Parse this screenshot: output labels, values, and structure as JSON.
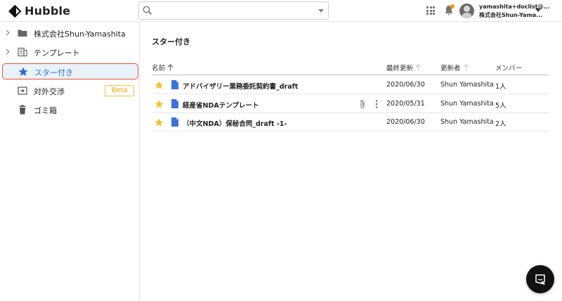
{
  "brand": {
    "name": "Hubble"
  },
  "search": {
    "placeholder": "",
    "value": ""
  },
  "account": {
    "email": "yamashita+doclist@...",
    "company": "株式会社Shun-Yama..."
  },
  "colors": {
    "accent": "#2b6fd6",
    "star": "#f5c02a",
    "badge": "#e6a700",
    "highlight_border": "#e8532f",
    "doc": "#3b73d9"
  },
  "sidebar": {
    "items": [
      {
        "label": "株式会社Shun-Yamashita",
        "icon": "folder-icon",
        "expandable": true
      },
      {
        "label": "テンプレート",
        "icon": "template-icon",
        "expandable": true
      },
      {
        "label": "スター付き",
        "icon": "star-icon",
        "active": true
      },
      {
        "label": "対外交渉",
        "icon": "external-negotiation-icon",
        "badge": "Beta"
      },
      {
        "label": "ゴミ箱",
        "icon": "trash-icon"
      }
    ]
  },
  "main": {
    "title": "スター付き",
    "columns": [
      "名前",
      "最終更新",
      "更新者",
      "メンバー"
    ],
    "rows": [
      {
        "name": "アドバイザリー業務委託契約書_draft",
        "updated": "2020/06/30",
        "updater": "Shun Yamashita",
        "members": "1人",
        "starred": true
      },
      {
        "name": "経産省NDAテンプレート",
        "updated": "2020/05/31",
        "updater": "Shun Yamashita",
        "members": "5人",
        "starred": true,
        "has_attachment": true
      },
      {
        "name": "（中文NDA）保秘合同_draft -1-",
        "updated": "2020/06/30",
        "updater": "Shun Yamashita",
        "members": "2人",
        "starred": true
      }
    ]
  }
}
